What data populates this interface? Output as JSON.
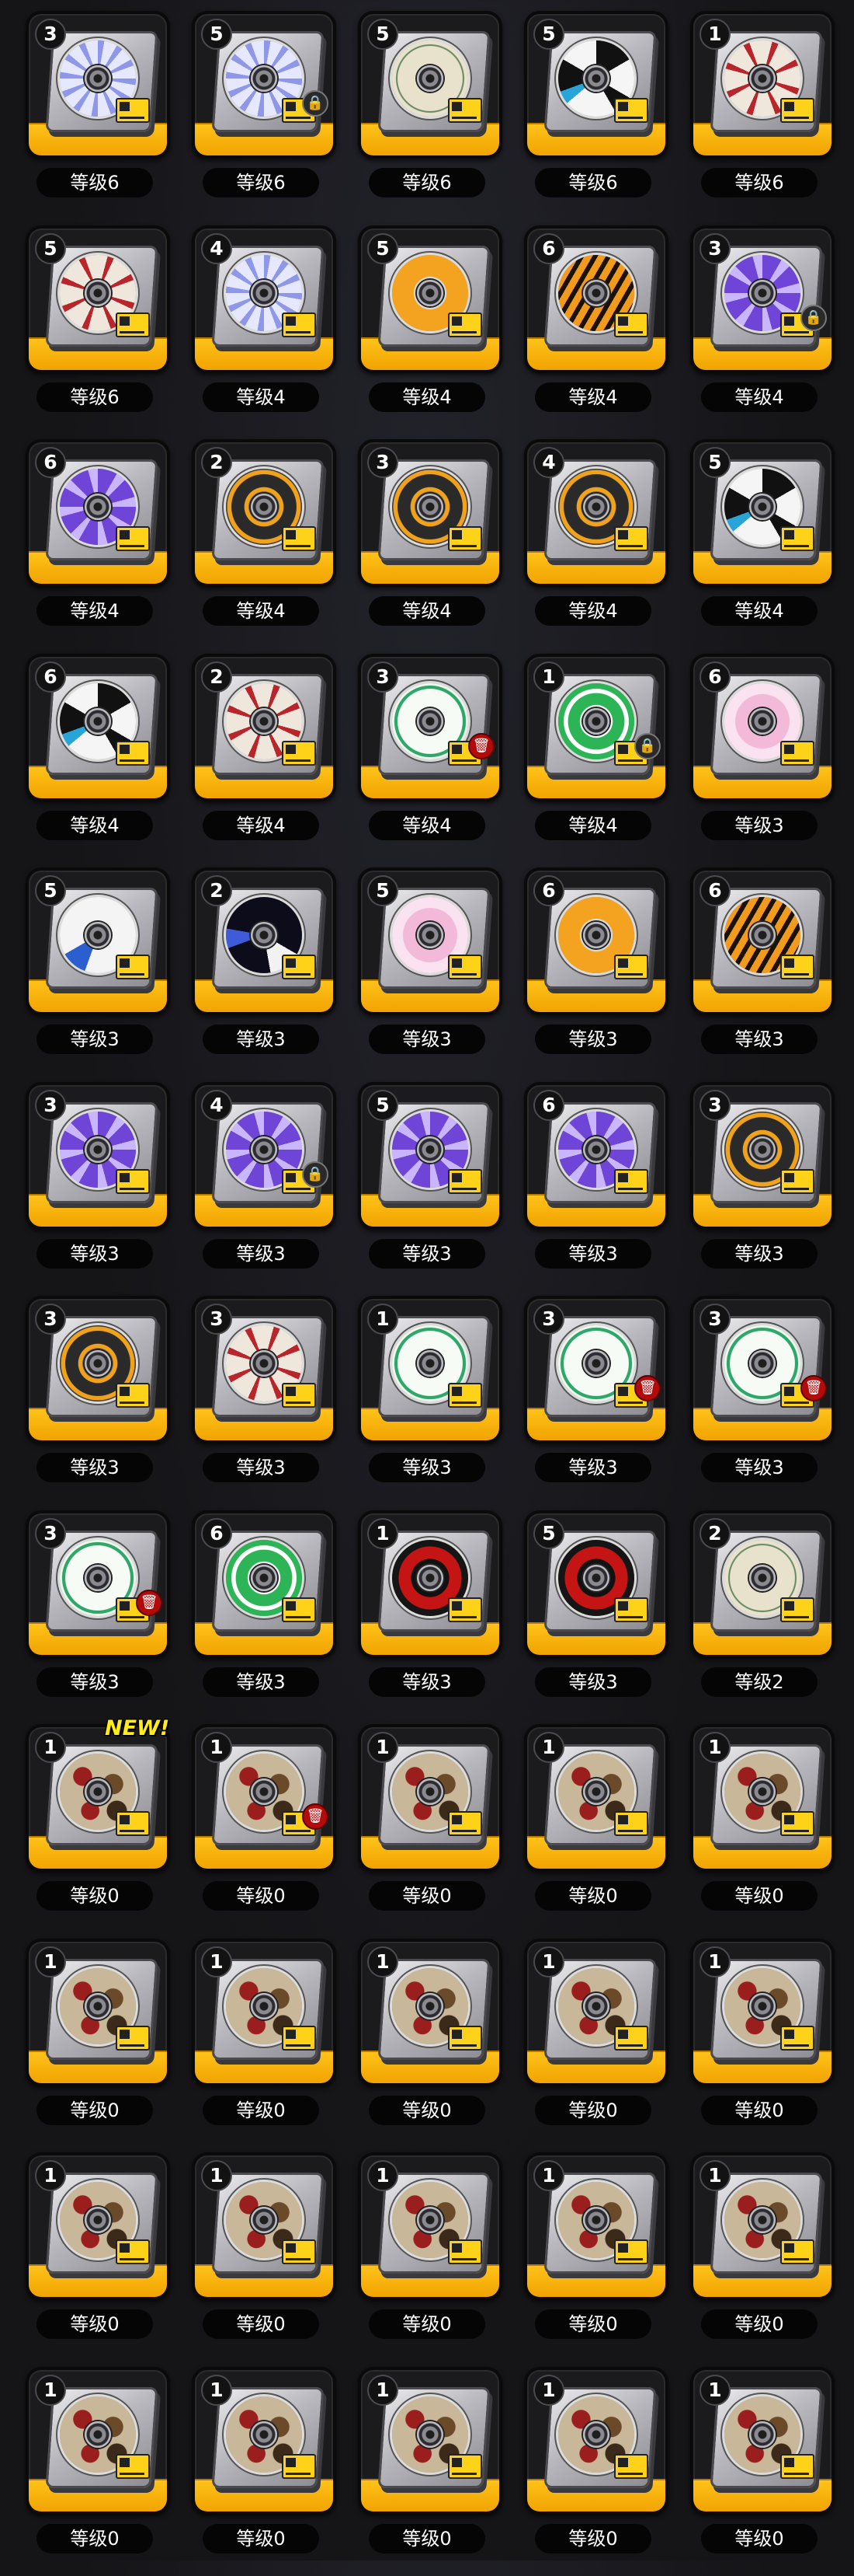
{
  "colors": {
    "background": "#17171a",
    "card_bottom": "#ffc21a",
    "level_pill": "#050505",
    "rank_text": "#ffffff",
    "new_tag": "#ffec17",
    "trash_badge": "#b30b0b"
  },
  "items": [
    {
      "rank": "3",
      "level": "等级6",
      "disc": "blue-petal",
      "badge": ""
    },
    {
      "rank": "5",
      "level": "等级6",
      "disc": "blue-petal",
      "badge": "lock"
    },
    {
      "rank": "5",
      "level": "等级6",
      "disc": "shuriken",
      "badge": ""
    },
    {
      "rank": "5",
      "level": "等级6",
      "disc": "monochrome",
      "badge": ""
    },
    {
      "rank": "1",
      "level": "等级6",
      "disc": "red-petal",
      "badge": ""
    },
    {
      "rank": "5",
      "level": "等级6",
      "disc": "red-petal",
      "badge": ""
    },
    {
      "rank": "4",
      "level": "等级4",
      "disc": "blue-petal",
      "badge": ""
    },
    {
      "rank": "5",
      "level": "等级4",
      "disc": "orange-quad",
      "badge": ""
    },
    {
      "rank": "6",
      "level": "等级4",
      "disc": "tiger",
      "badge": ""
    },
    {
      "rank": "3",
      "level": "等级4",
      "disc": "purple-pinwheel",
      "badge": "lock"
    },
    {
      "rank": "6",
      "level": "等级4",
      "disc": "purple-pinwheel",
      "badge": ""
    },
    {
      "rank": "2",
      "level": "等级4",
      "disc": "orange-ring",
      "badge": ""
    },
    {
      "rank": "3",
      "level": "等级4",
      "disc": "orange-ring",
      "badge": ""
    },
    {
      "rank": "4",
      "level": "等级4",
      "disc": "orange-ring",
      "badge": ""
    },
    {
      "rank": "5",
      "level": "等级4",
      "disc": "monochrome",
      "badge": ""
    },
    {
      "rank": "6",
      "level": "等级4",
      "disc": "monochrome",
      "badge": ""
    },
    {
      "rank": "2",
      "level": "等级4",
      "disc": "red-petal",
      "badge": ""
    },
    {
      "rank": "3",
      "level": "等级4",
      "disc": "mint-eyes",
      "badge": "trash"
    },
    {
      "rank": "1",
      "level": "等级4",
      "disc": "green-swirl",
      "badge": "lock"
    },
    {
      "rank": "6",
      "level": "等级3",
      "disc": "pink-rose",
      "badge": ""
    },
    {
      "rank": "5",
      "level": "等级3",
      "disc": "white-blue",
      "badge": ""
    },
    {
      "rank": "2",
      "level": "等级3",
      "disc": "dark-blue",
      "badge": ""
    },
    {
      "rank": "5",
      "level": "等级3",
      "disc": "pink-rose",
      "badge": ""
    },
    {
      "rank": "6",
      "level": "等级3",
      "disc": "orange-quad",
      "badge": ""
    },
    {
      "rank": "6",
      "level": "等级3",
      "disc": "tiger",
      "badge": ""
    },
    {
      "rank": "3",
      "level": "等级3",
      "disc": "purple-pinwheel",
      "badge": ""
    },
    {
      "rank": "4",
      "level": "等级3",
      "disc": "purple-pinwheel",
      "badge": "lock"
    },
    {
      "rank": "5",
      "level": "等级3",
      "disc": "purple-pinwheel",
      "badge": ""
    },
    {
      "rank": "6",
      "level": "等级3",
      "disc": "purple-pinwheel",
      "badge": ""
    },
    {
      "rank": "3",
      "level": "等级3",
      "disc": "orange-ring",
      "badge": ""
    },
    {
      "rank": "3",
      "level": "等级3",
      "disc": "orange-ring",
      "badge": ""
    },
    {
      "rank": "3",
      "level": "等级3",
      "disc": "red-petal",
      "badge": ""
    },
    {
      "rank": "1",
      "level": "等级3",
      "disc": "mint-eyes",
      "badge": ""
    },
    {
      "rank": "3",
      "level": "等级3",
      "disc": "mint-eyes",
      "badge": "trash"
    },
    {
      "rank": "3",
      "level": "等级3",
      "disc": "mint-eyes",
      "badge": "trash"
    },
    {
      "rank": "3",
      "level": "等级3",
      "disc": "mint-eyes",
      "badge": "trash"
    },
    {
      "rank": "6",
      "level": "等级3",
      "disc": "green-swirl",
      "badge": ""
    },
    {
      "rank": "1",
      "level": "等级3",
      "disc": "red-black",
      "badge": ""
    },
    {
      "rank": "5",
      "level": "等级3",
      "disc": "red-black",
      "badge": ""
    },
    {
      "rank": "2",
      "level": "等级2",
      "disc": "shuriken",
      "badge": ""
    },
    {
      "rank": "1",
      "level": "等级0",
      "disc": "camo",
      "badge": "",
      "new": "NEW!"
    },
    {
      "rank": "1",
      "level": "等级0",
      "disc": "camo",
      "badge": "trash"
    },
    {
      "rank": "1",
      "level": "等级0",
      "disc": "camo",
      "badge": ""
    },
    {
      "rank": "1",
      "level": "等级0",
      "disc": "camo",
      "badge": ""
    },
    {
      "rank": "1",
      "level": "等级0",
      "disc": "camo",
      "badge": ""
    },
    {
      "rank": "1",
      "level": "等级0",
      "disc": "camo",
      "badge": ""
    },
    {
      "rank": "1",
      "level": "等级0",
      "disc": "camo",
      "badge": ""
    },
    {
      "rank": "1",
      "level": "等级0",
      "disc": "camo",
      "badge": ""
    },
    {
      "rank": "1",
      "level": "等级0",
      "disc": "camo",
      "badge": ""
    },
    {
      "rank": "1",
      "level": "等级0",
      "disc": "camo",
      "badge": ""
    },
    {
      "rank": "1",
      "level": "等级0",
      "disc": "camo",
      "badge": ""
    },
    {
      "rank": "1",
      "level": "等级0",
      "disc": "camo",
      "badge": ""
    },
    {
      "rank": "1",
      "level": "等级0",
      "disc": "camo",
      "badge": ""
    },
    {
      "rank": "1",
      "level": "等级0",
      "disc": "camo",
      "badge": ""
    },
    {
      "rank": "1",
      "level": "等级0",
      "disc": "camo",
      "badge": ""
    },
    {
      "rank": "1",
      "level": "等级0",
      "disc": "camo",
      "badge": ""
    },
    {
      "rank": "1",
      "level": "等级0",
      "disc": "camo",
      "badge": ""
    },
    {
      "rank": "1",
      "level": "等级0",
      "disc": "camo",
      "badge": ""
    },
    {
      "rank": "1",
      "level": "等级0",
      "disc": "camo",
      "badge": ""
    },
    {
      "rank": "1",
      "level": "等级0",
      "disc": "camo",
      "badge": ""
    }
  ]
}
